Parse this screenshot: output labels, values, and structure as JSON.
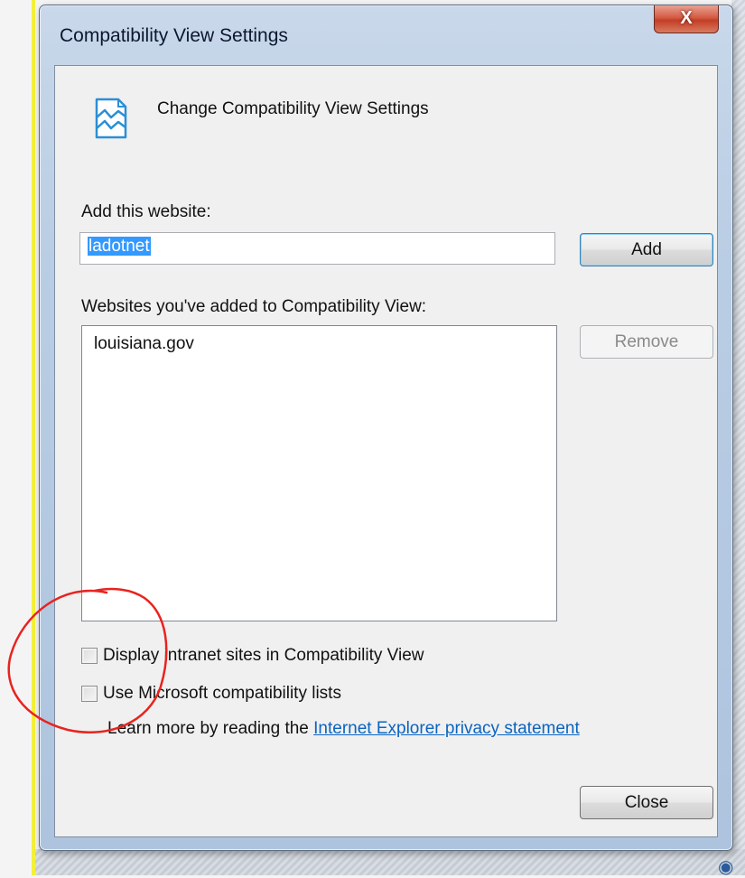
{
  "window": {
    "title": "Compatibility View Settings",
    "close_glyph": "X"
  },
  "header": {
    "icon": "compatibility-view-icon",
    "text": "Change Compatibility View Settings"
  },
  "add_site": {
    "label": "Add this website:",
    "value": "ladotnet",
    "add_button": "Add"
  },
  "site_list": {
    "label": "Websites you've added to Compatibility View:",
    "items": [
      "louisiana.gov"
    ],
    "remove_button": "Remove"
  },
  "options": {
    "intranet_label": "Display intranet sites in Compatibility View",
    "intranet_checked": false,
    "ms_lists_label": "Use Microsoft compatibility lists",
    "ms_lists_checked": false
  },
  "learn_more": {
    "prefix": "Learn more by reading the ",
    "link": "Internet Explorer privacy statement"
  },
  "footer": {
    "close_button": "Close"
  },
  "colors": {
    "annotation": "#e8231f",
    "link": "#0b64c0",
    "selection": "#3399ff"
  }
}
